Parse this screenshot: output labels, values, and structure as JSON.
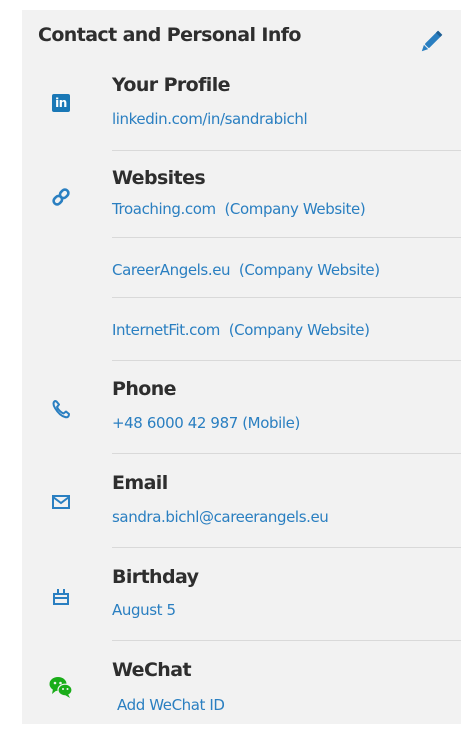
{
  "header": {
    "title": "Contact and Personal Info"
  },
  "profile": {
    "title": "Your Profile",
    "url": "linkedin.com/in/sandrabichl",
    "icon": "linkedin-icon"
  },
  "websites": {
    "title": "Websites",
    "icon": "link-icon",
    "items": [
      {
        "url": "Troaching.com",
        "type": "(Company Website)"
      },
      {
        "url": "CareerAngels.eu",
        "type": "(Company Website)"
      },
      {
        "url": "InternetFit.com",
        "type": "(Company Website)"
      }
    ]
  },
  "phone": {
    "title": "Phone",
    "value": "+48 6000 42 987 (Mobile)",
    "icon": "phone-icon"
  },
  "email": {
    "title": "Email",
    "value": "sandra.bichl@careerangels.eu",
    "icon": "envelope-icon"
  },
  "birthday": {
    "title": "Birthday",
    "value": "August 5",
    "icon": "cake-icon"
  },
  "wechat": {
    "title": "WeChat",
    "action": "Add WeChat ID",
    "icon": "wechat-icon"
  },
  "colors": {
    "panel_bg": "#f2f2f2",
    "link": "#2a7fc1",
    "text": "#2e2e2e",
    "divider": "#d9d9d9",
    "wechat_green": "#1aad19"
  }
}
